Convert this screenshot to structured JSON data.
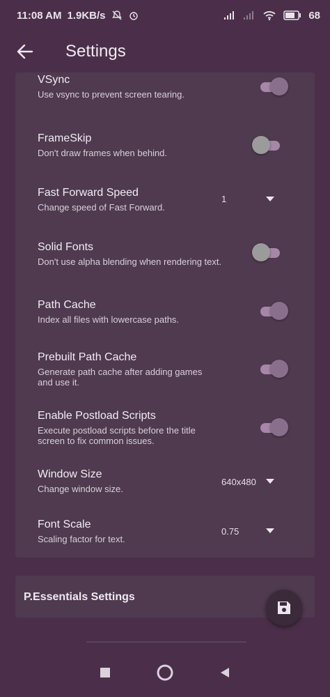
{
  "status_bar": {
    "time": "11:08 AM",
    "speed": "1.9KB/s",
    "battery": "68"
  },
  "app_bar": {
    "title": "Settings"
  },
  "settings": [
    {
      "title": "VSync",
      "subtitle": "Use vsync to prevent screen tearing.",
      "control": "toggle",
      "on": true
    },
    {
      "title": "FrameSkip",
      "subtitle": "Don't draw frames when behind.",
      "control": "toggle",
      "on": false
    },
    {
      "title": "Fast Forward Speed",
      "subtitle": "Change speed of Fast Forward.",
      "control": "dropdown",
      "value": "1"
    },
    {
      "title": "Solid Fonts",
      "subtitle": "Don't use alpha blending when rendering text.",
      "control": "toggle",
      "on": false
    },
    {
      "title": "Path Cache",
      "subtitle": "Index all files with lowercase paths.",
      "control": "toggle",
      "on": true
    },
    {
      "title": "Prebuilt Path Cache",
      "subtitle": "Generate path cache after adding games and use it.",
      "control": "toggle",
      "on": true
    },
    {
      "title": "Enable Postload Scripts",
      "subtitle": "Execute postload scripts before the title screen to fix common issues.",
      "control": "toggle",
      "on": true
    },
    {
      "title": "Window Size",
      "subtitle": "Change window size.",
      "control": "dropdown",
      "value": "640x480"
    },
    {
      "title": "Font Scale",
      "subtitle": "Scaling factor for text.",
      "control": "dropdown",
      "value": "0.75"
    }
  ],
  "section2": {
    "label": "P.Essentials Settings"
  },
  "fab": {
    "icon": "save-icon"
  },
  "nav": {
    "icons": [
      "square-recents-icon",
      "circle-home-icon",
      "triangle-back-icon"
    ]
  }
}
